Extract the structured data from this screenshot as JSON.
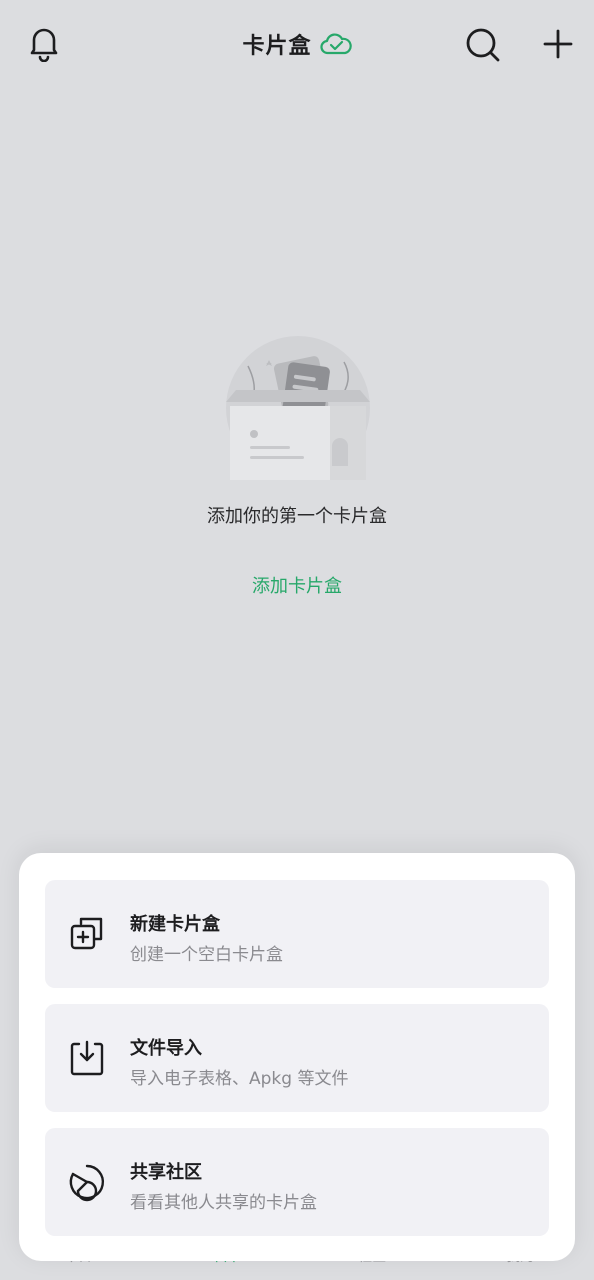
{
  "header": {
    "title": "卡片盒",
    "sync_icon": "cloud-check-icon",
    "left_icon": "bell-icon",
    "right_icons": [
      "search-icon",
      "plus-icon"
    ],
    "accent_color": "#27a86a"
  },
  "empty_state": {
    "illustration": "card-box-illustration",
    "message": "添加你的第一个卡片盒",
    "action_label": "添加卡片盒"
  },
  "bottom_sheet": {
    "options": [
      {
        "icon": "new-box-icon",
        "title": "新建卡片盒",
        "subtitle": "创建一个空白卡片盒"
      },
      {
        "icon": "import-icon",
        "title": "文件导入",
        "subtitle": "导入电子表格、Apkg 等文件"
      },
      {
        "icon": "community-icon",
        "title": "共享社区",
        "subtitle": "看看其他人共享的卡片盒"
      }
    ]
  },
  "tabbar": {
    "tabs": [
      {
        "label": "今日",
        "active": false
      },
      {
        "label": "卡片",
        "active": true
      },
      {
        "label": "社区",
        "active": false
      },
      {
        "label": "我的",
        "active": false
      }
    ]
  }
}
